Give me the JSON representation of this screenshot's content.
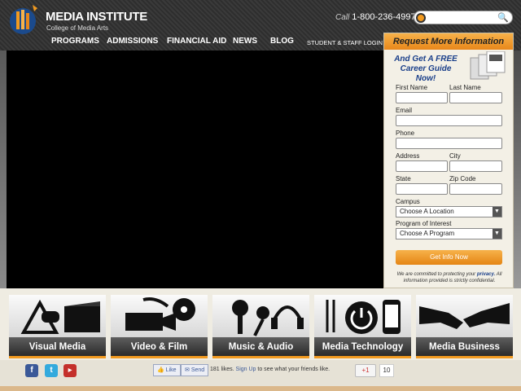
{
  "brand": {
    "name": "MEDIA INSTITUTE",
    "tagline": "College of Media Arts",
    "accent": "#f29a1f"
  },
  "header": {
    "phone_prefix": "Call",
    "phone_number": "1-800-236-4997",
    "search_placeholder": ""
  },
  "nav": {
    "items": [
      {
        "label": "PROGRAMS"
      },
      {
        "label": "ADMISSIONS"
      },
      {
        "label": "FINANCIAL AID"
      },
      {
        "label": "NEWS"
      },
      {
        "label": "BLOG"
      },
      {
        "label": "STUDENT & STAFF LOGIN"
      }
    ]
  },
  "form": {
    "header": "Request More Information",
    "promo": "And Get A FREE Career Guide Now!",
    "fields": {
      "first_name": "First Name",
      "last_name": "Last Name",
      "email": "Email",
      "phone": "Phone",
      "address": "Address",
      "city": "City",
      "state": "State",
      "zip": "Zip Code",
      "campus": "Campus",
      "program": "Program of Interest"
    },
    "campus_selected": "Choose A Location",
    "program_selected": "Choose A Program",
    "submit": "Get Info Now",
    "privacy_prefix": "We are committed to protecting your",
    "privacy_link": "privacy.",
    "privacy_suffix": "All information provided is strictly confidential."
  },
  "categories": [
    {
      "label": "Visual Media",
      "icon": "art-tools-icon"
    },
    {
      "label": "Video & Film",
      "icon": "film-camera-icon"
    },
    {
      "label": "Music & Audio",
      "icon": "microphone-icon"
    },
    {
      "label": "Media Technology",
      "icon": "power-devices-icon"
    },
    {
      "label": "Media Business",
      "icon": "handshake-icon"
    }
  ],
  "social": {
    "like": "Like",
    "send": "Send",
    "likes_count": "181 likes.",
    "signup": "Sign Up",
    "signup_suffix": "to see what your friends like.",
    "gplus": "+1",
    "gplus_count": "10"
  }
}
